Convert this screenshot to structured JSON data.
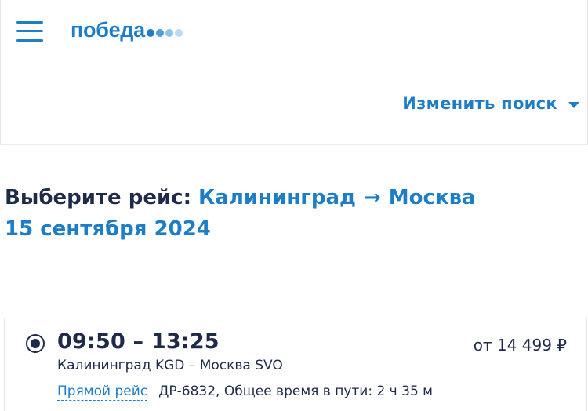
{
  "header": {
    "logo_text": "победа",
    "logo_dot_colors": [
      "#1d7ec7",
      "#4f9fd9",
      "#8cc4ec",
      "#b9dcf5"
    ],
    "change_search_label": "Изменить поиск"
  },
  "selection": {
    "prefix": "Выберите рейс:",
    "from_city": "Калининград",
    "arrow": "→",
    "to_city": "Москва",
    "date": "15 сентября 2024"
  },
  "flight": {
    "times": "09:50 – 13:25",
    "price": "от 14 499 ₽",
    "route": "Калининград KGD – Москва SVO",
    "direct_label": "Прямой рейс",
    "details": "ДР-6832, Общее время в пути: 2 ч 35 м"
  },
  "colors": {
    "accent": "#1d7ec7",
    "text_dark": "#1e2a4a"
  }
}
